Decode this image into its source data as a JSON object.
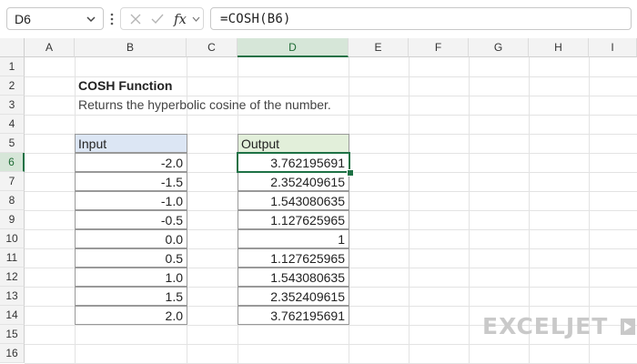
{
  "formula_bar": {
    "name_box": "D6",
    "formula": "=COSH(B6)",
    "fx_label": "fx"
  },
  "columns": [
    "A",
    "B",
    "C",
    "D",
    "E",
    "F",
    "G",
    "H",
    "I"
  ],
  "rows": [
    "1",
    "2",
    "3",
    "4",
    "5",
    "6",
    "7",
    "8",
    "9",
    "10",
    "11",
    "12",
    "13",
    "14",
    "15",
    "16"
  ],
  "selected_column": "D",
  "selected_row": "6",
  "sheet": {
    "title": "COSH Function",
    "subtitle": "Returns the hyperbolic cosine of the number.",
    "input_header": "Input",
    "output_header": "Output",
    "inputs": [
      "-2.0",
      "-1.5",
      "-1.0",
      "-0.5",
      "0.0",
      "0.5",
      "1.0",
      "1.5",
      "2.0"
    ],
    "outputs": [
      "3.762195691",
      "2.352409615",
      "1.543080635",
      "1.127625965",
      "1",
      "1.127625965",
      "1.543080635",
      "2.352409615",
      "3.762195691"
    ],
    "header_colors": {
      "input": "#dce6f4",
      "output": "#e2efda"
    },
    "accent_color": "#1e7145"
  },
  "watermark": "EXCELJET"
}
